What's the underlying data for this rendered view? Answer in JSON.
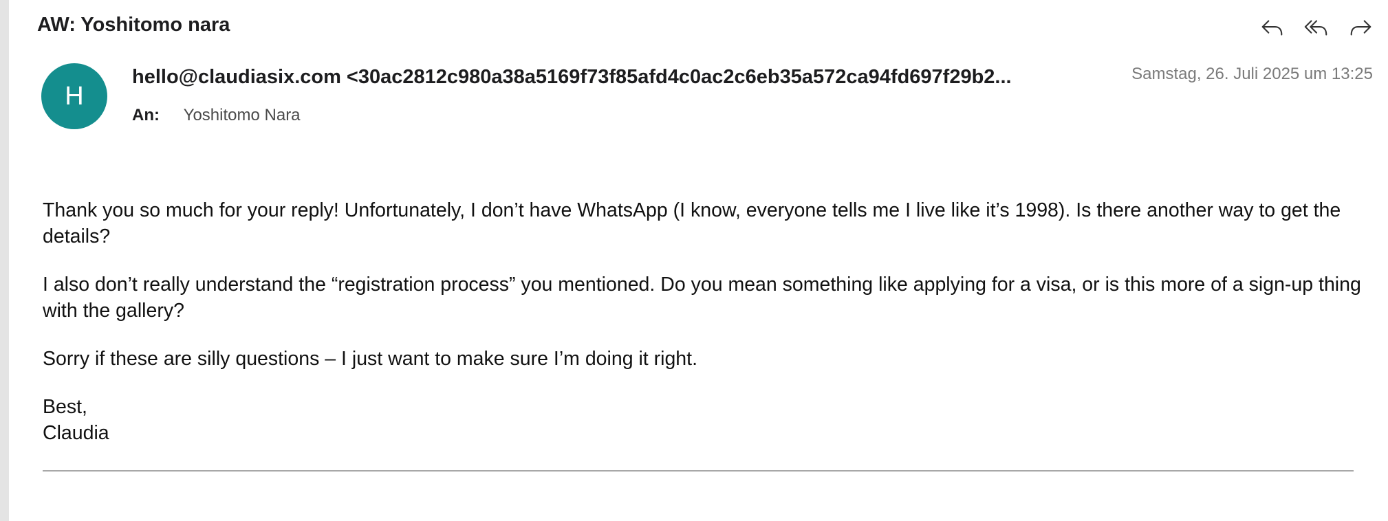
{
  "email": {
    "subject": "AW: Yoshitomo nara",
    "avatar_letter": "H",
    "sender": "hello@claudiasix.com <30ac2812c980a38a5169f73f85afd4c0ac2c6eb35a572ca94fd697f29b2...",
    "date": "Samstag, 26. Juli 2025 um 13:25",
    "to_label": "An:",
    "to_value": "Yoshitomo Nara",
    "body": {
      "p1": "Thank you so much for your reply! Unfortunately, I don’t have WhatsApp (I know, everyone tells me I live like it’s 1998). Is there another way to get the details?",
      "p2": "I also don’t really understand the “registration process” you mentioned. Do you mean something like applying for a visa, or is this more of a sign-up thing with the gallery?",
      "p3": "Sorry if these are silly questions – I just want to make sure I’m doing it right.",
      "closing": "Best,",
      "signature": "Claudia"
    }
  },
  "toolbar": {
    "reply_icon": "reply-icon",
    "reply_all_icon": "reply-all-icon",
    "forward_icon": "forward-icon"
  },
  "colors": {
    "avatar": "#148e8e",
    "date_text": "#7a7a7a",
    "left_strip": "#e4e4e4"
  }
}
